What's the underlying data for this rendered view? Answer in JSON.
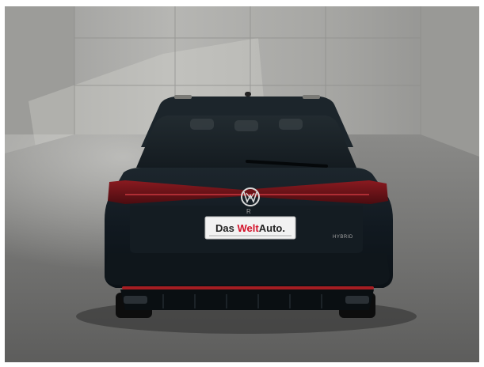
{
  "photo": {
    "plate": {
      "prefix": "Das ",
      "highlight": "Welt",
      "suffix": "Auto.",
      "highlight_color": "#d4132b"
    },
    "badge": "HYBRID",
    "colors": {
      "car_body": "#121a20",
      "taillight": "#7a1318",
      "wall": "#a9a9a6",
      "floor": "#6f6f6d"
    }
  }
}
